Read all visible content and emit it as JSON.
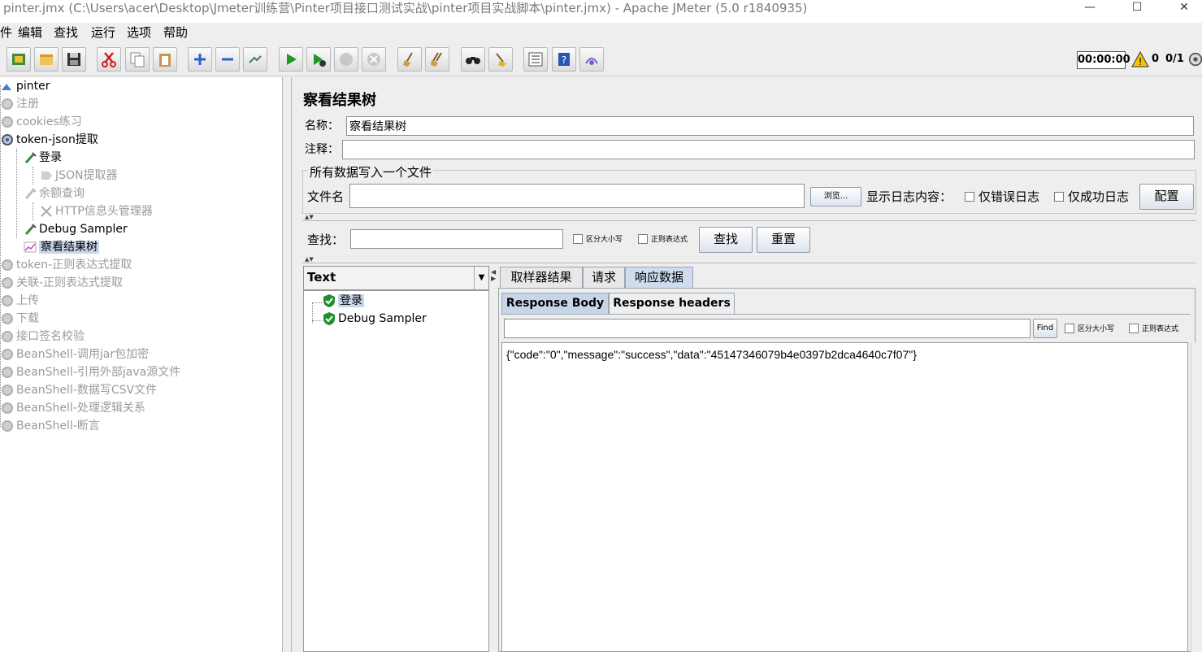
{
  "window": {
    "title": "pinter.jmx (C:\\Users\\acer\\Desktop\\Jmeter训练营\\Pinter项目接口测试实战\\pinter项目实战脚本\\pinter.jmx) - Apache JMeter (5.0 r1840935)",
    "minimize": "—",
    "maximize": "☐",
    "close": "✕"
  },
  "menu": {
    "file": "件",
    "edit": "编辑",
    "search": "查找",
    "run": "运行",
    "options": "选项",
    "help": "帮助"
  },
  "toolbar": {
    "timer": "00:00:00",
    "warnings": "0",
    "threads": "0/1"
  },
  "tree": {
    "root": "pinter",
    "items": [
      {
        "label": "注册",
        "disabled": true
      },
      {
        "label": "cookies练习",
        "disabled": true
      },
      {
        "label": "token-json提取",
        "disabled": false
      },
      {
        "label": "登录",
        "disabled": false
      },
      {
        "label": "JSON提取器",
        "disabled": true
      },
      {
        "label": "余额查询",
        "disabled": true
      },
      {
        "label": "HTTP信息头管理器",
        "disabled": true
      },
      {
        "label": "Debug Sampler",
        "disabled": false
      },
      {
        "label": "察看结果树",
        "disabled": false
      },
      {
        "label": "token-正则表达式提取",
        "disabled": true
      },
      {
        "label": "关联-正则表达式提取",
        "disabled": true
      },
      {
        "label": "上传",
        "disabled": true
      },
      {
        "label": "下载",
        "disabled": true
      },
      {
        "label": "接口签名校验",
        "disabled": true
      },
      {
        "label": "BeanShell-调用jar包加密",
        "disabled": true
      },
      {
        "label": "BeanShell-引用外部java源文件",
        "disabled": true
      },
      {
        "label": "BeanShell-数据写CSV文件",
        "disabled": true
      },
      {
        "label": "BeanShell-处理逻辑关系",
        "disabled": true
      },
      {
        "label": "BeanShell-断言",
        "disabled": true
      }
    ]
  },
  "panel": {
    "title": "察看结果树",
    "name_label": "名称：",
    "name_value": "察看结果树",
    "comment_label": "注释：",
    "comment_value": "",
    "group_title": "所有数据写入一个文件",
    "filename_label": "文件名",
    "filename_value": "",
    "browse_button": "浏览...",
    "log_label": "显示日志内容：",
    "errors_only": "仅错误日志",
    "success_only": "仅成功日志",
    "config_button": "配置",
    "search_label": "查找：",
    "search_value": "",
    "case_sensitive": "区分大小写",
    "regex": "正则表达式",
    "find_button": "查找",
    "reset_button": "重置"
  },
  "results": {
    "renderer": "Text",
    "samples": [
      "登录",
      "Debug Sampler"
    ],
    "tabs": [
      "取样器结果",
      "请求",
      "响应数据"
    ],
    "subtabs": [
      "Response Body",
      "Response headers"
    ],
    "find_button": "Find",
    "case_sensitive": "区分大小写",
    "regex": "正则表达式",
    "find_value": "",
    "response_body": "{\"code\":\"0\",\"message\":\"success\",\"data\":\"45147346079b4e0397b2dca4640c7f07\"}"
  }
}
